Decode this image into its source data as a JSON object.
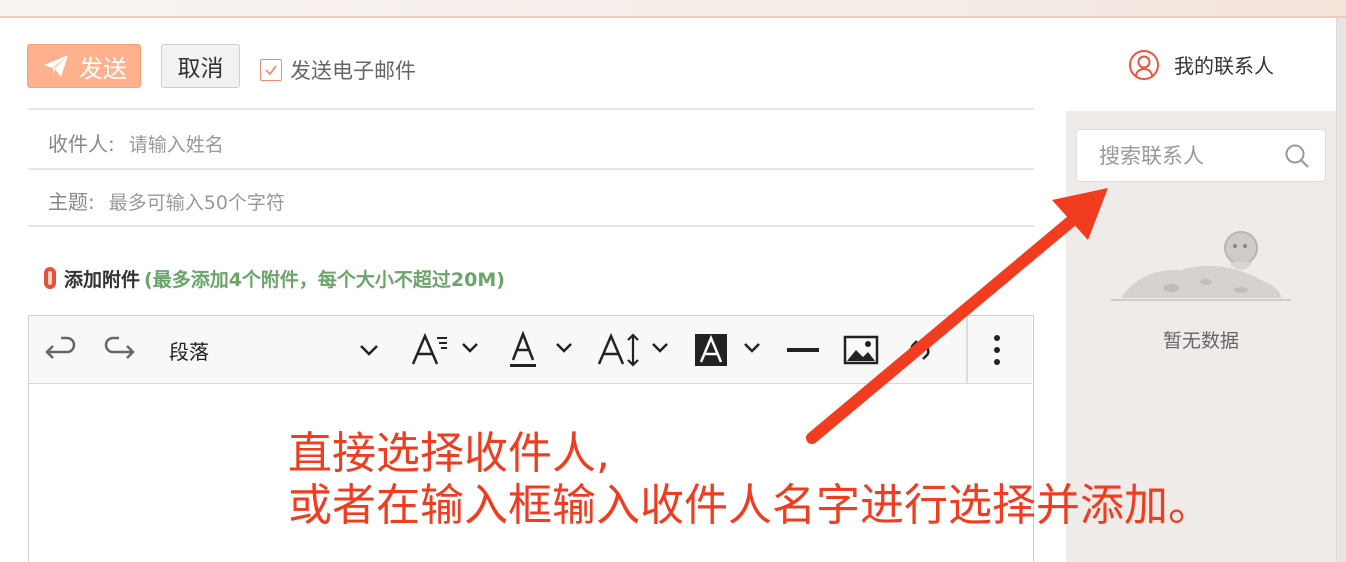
{
  "toolbar": {
    "send_label": "发送",
    "cancel_label": "取消",
    "email_label": "发送电子邮件",
    "email_checked": true
  },
  "fields": {
    "recipient_label": "收件人:",
    "recipient_placeholder": "请输入姓名",
    "subject_label": "主题:",
    "subject_placeholder": "最多可输入50个字符"
  },
  "attachment": {
    "label": "添加附件",
    "hint": "(最多添加4个附件，每个大小不超过20M)"
  },
  "editor": {
    "paragraph_label": "段落",
    "icons": [
      "undo-icon",
      "redo-icon",
      "chevron-down-icon",
      "font-size-icon",
      "font-color-icon",
      "line-height-icon",
      "background-color-icon",
      "horizontal-rule-icon",
      "image-icon",
      "link-icon",
      "more-icon"
    ]
  },
  "sidebar": {
    "title": "我的联系人",
    "search_placeholder": "搜索联系人",
    "empty_text": "暂无数据"
  },
  "annotation": {
    "line1": "直接选择收件人,",
    "line2": "或者在输入框输入收件人名字进行选择并添加。"
  },
  "colors": {
    "accent": "#ffb08c",
    "annotation": "#f13c20",
    "hint_green": "#6aa56a"
  }
}
